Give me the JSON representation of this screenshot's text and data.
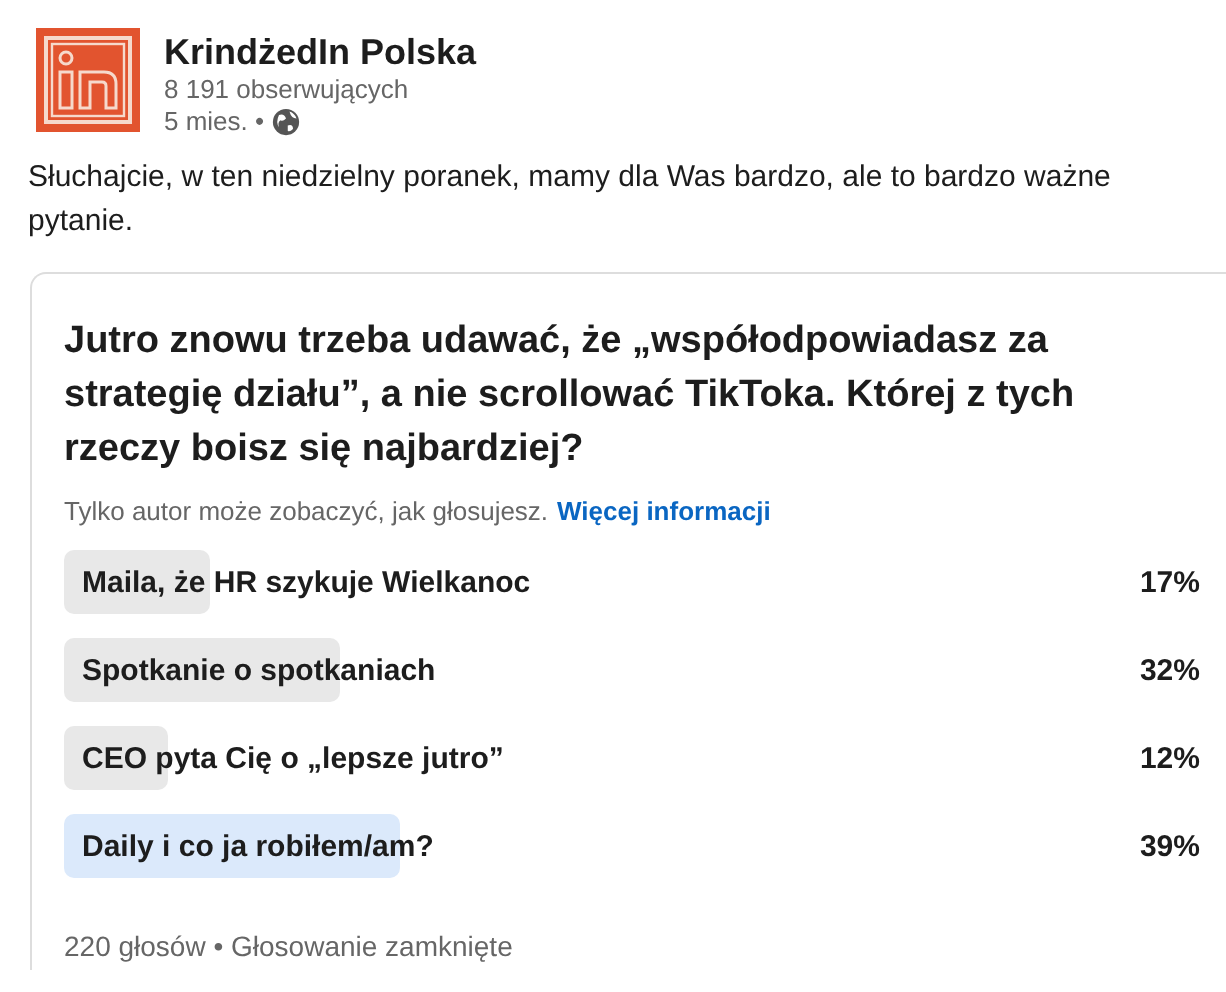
{
  "author": {
    "name": "KrindżedIn Polska",
    "followers": "8 191 obserwujących",
    "time": "5 mies. •"
  },
  "post_text": "Słuchajcie, w ten niedzielny poranek, mamy dla Was bardzo, ale to bardzo ważne pytanie.",
  "poll": {
    "question": "Jutro znowu trzeba udawać, że „współodpowiadasz za strategię działu”, a nie scrollować TikToka. Której z tych rzeczy boisz się najbardziej?",
    "privacy_note": "Tylko autor może zobaczyć, jak głosujesz.",
    "more_link": "Więcej informacji",
    "options": [
      {
        "label": "Maila, że HR szykuje Wielkanoc",
        "percent": "17%",
        "selected": false
      },
      {
        "label": "Spotkanie o spotkaniach",
        "percent": "32%",
        "selected": false
      },
      {
        "label": "CEO pyta Cię o „lepsze jutro”",
        "percent": "12%",
        "selected": false
      },
      {
        "label": "Daily i co ja robiłem/am?",
        "percent": "39%",
        "selected": true
      }
    ],
    "footer": "220 głosów • Głosowanie zamknięte"
  }
}
